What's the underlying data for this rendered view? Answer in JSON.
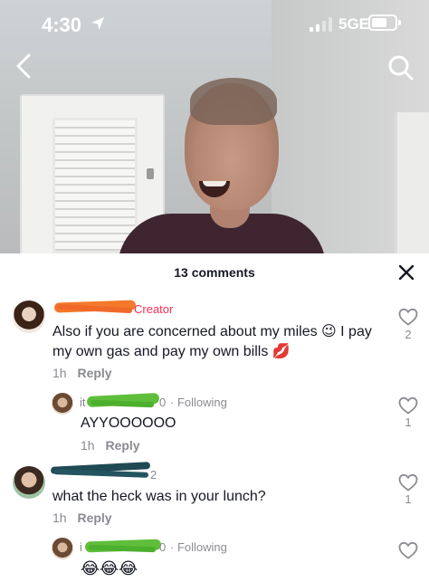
{
  "status_bar": {
    "time": "4:30",
    "network": "5GE"
  },
  "header": {
    "back_icon": "chevron-left-icon",
    "search_icon": "search-icon"
  },
  "sheet": {
    "title": "13 comments",
    "close_icon": "close-icon"
  },
  "comments": [
    {
      "username_fragment": "Creator",
      "text": "Also if you are concerned about my miles 😉 I pay my own gas and pay my own bills 💋",
      "time": "1h",
      "reply_label": "Reply",
      "likes": "2"
    },
    {
      "username_fragment_start": "it",
      "username_fragment_end": "0",
      "following_label": "· Following",
      "text": "AYYOOOOOO",
      "time": "1h",
      "reply_label": "Reply",
      "likes": "1"
    },
    {
      "username_fragment_end": "2",
      "text": "what the heck was in your lunch?",
      "time": "1h",
      "reply_label": "Reply",
      "likes": "1"
    },
    {
      "username_fragment_start": "i",
      "username_fragment_end": "0",
      "following_label": "· Following",
      "text": "😂😂😂"
    }
  ],
  "colors": {
    "accent": "#fe2c55",
    "redaction_orange": "#f5792b",
    "redaction_green": "#5fbe3a",
    "redaction_dark": "#1f4a54"
  }
}
